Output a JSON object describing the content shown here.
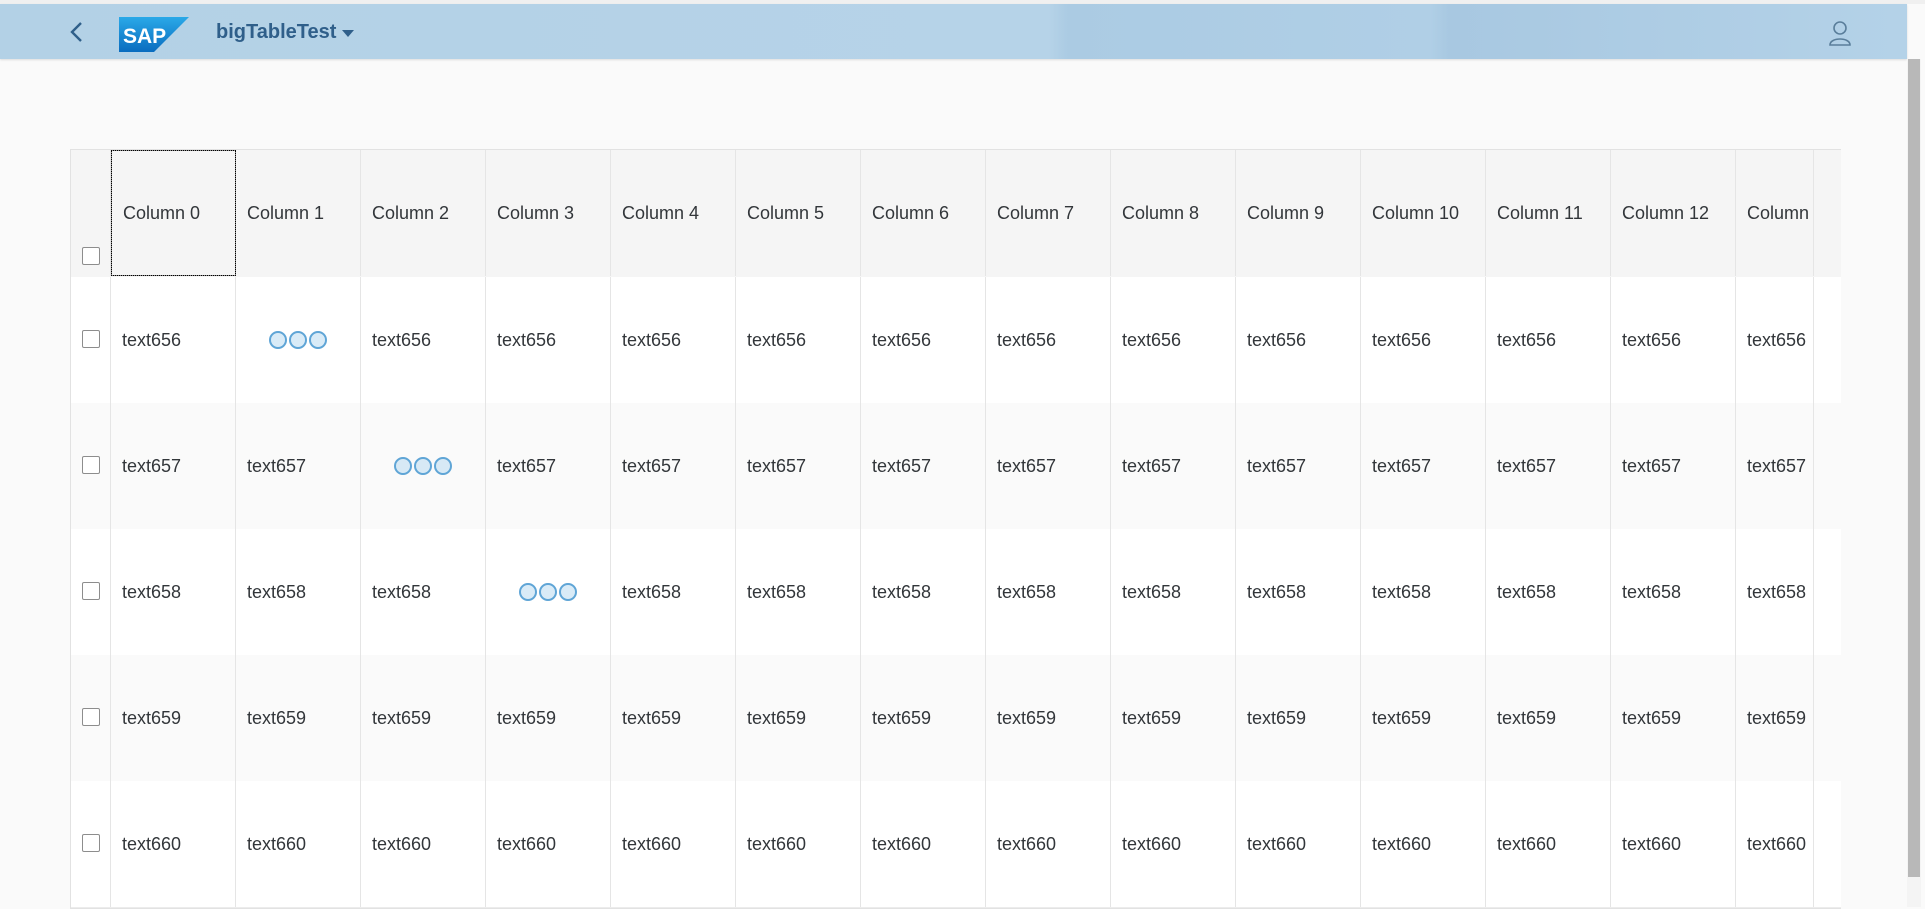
{
  "shell": {
    "app_title": "bigTableTest",
    "logo_text": "SAP",
    "icons": {
      "back": "back-arrow-icon",
      "user": "user-icon",
      "menu": "caret-down-icon"
    },
    "accent": "#2f5f8a",
    "bar_color": "#b3d1e6"
  },
  "table": {
    "columns": [
      "Column 0",
      "Column 1",
      "Column 2",
      "Column 3",
      "Column 4",
      "Column 5",
      "Column 6",
      "Column 7",
      "Column 8",
      "Column 9",
      "Column 10",
      "Column 11",
      "Column 12",
      "Column"
    ],
    "rows": [
      {
        "id": "656",
        "cells": [
          "text656",
          "",
          "text656",
          "text656",
          "text656",
          "text656",
          "text656",
          "text656",
          "text656",
          "text656",
          "text656",
          "text656",
          "text656",
          "text656"
        ],
        "busy_col": 1
      },
      {
        "id": "657",
        "cells": [
          "text657",
          "text657",
          "",
          "text657",
          "text657",
          "text657",
          "text657",
          "text657",
          "text657",
          "text657",
          "text657",
          "text657",
          "text657",
          "text657"
        ],
        "busy_col": 2
      },
      {
        "id": "658",
        "cells": [
          "text658",
          "text658",
          "text658",
          "",
          "text658",
          "text658",
          "text658",
          "text658",
          "text658",
          "text658",
          "text658",
          "text658",
          "text658",
          "text658"
        ],
        "busy_col": 3
      },
      {
        "id": "659",
        "cells": [
          "text659",
          "text659",
          "text659",
          "text659",
          "text659",
          "text659",
          "text659",
          "text659",
          "text659",
          "text659",
          "text659",
          "text659",
          "text659",
          "text659"
        ],
        "busy_col": -1
      },
      {
        "id": "660",
        "cells": [
          "text660",
          "text660",
          "text660",
          "text660",
          "text660",
          "text660",
          "text660",
          "text660",
          "text660",
          "text660",
          "text660",
          "text660",
          "text660",
          "text660"
        ],
        "busy_col": -1
      }
    ]
  }
}
